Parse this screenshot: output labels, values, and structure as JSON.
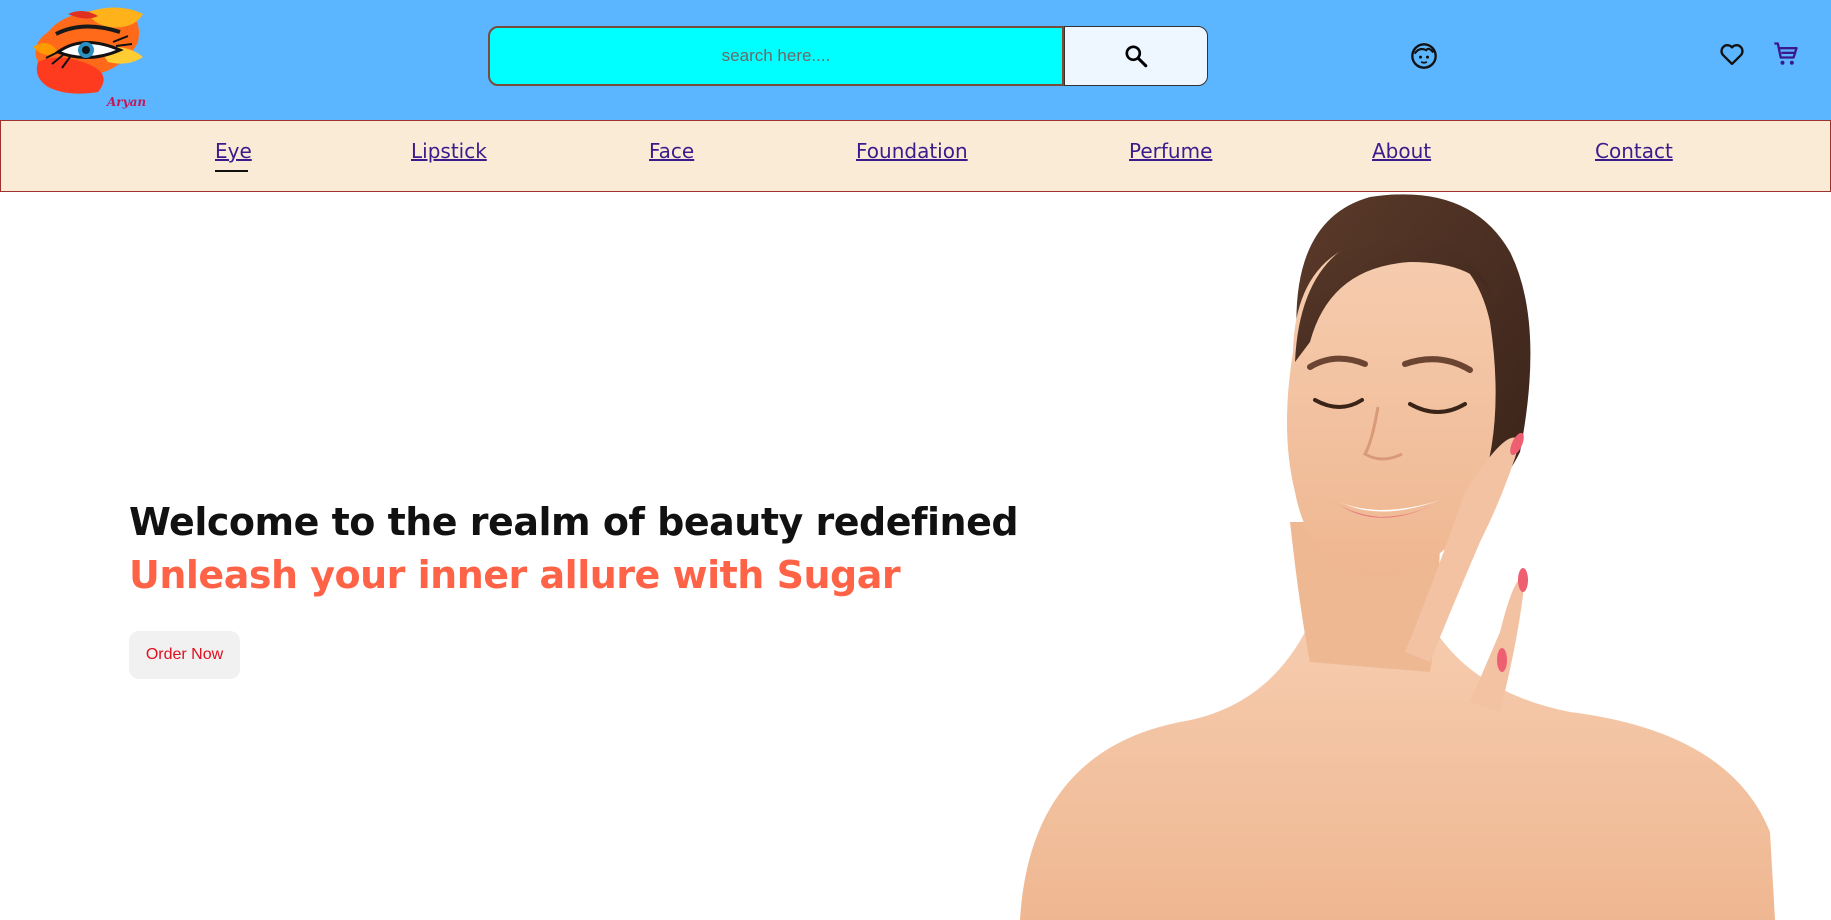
{
  "logo": {
    "text": "Aryan",
    "icon": "eye-paint-logo"
  },
  "search": {
    "placeholder": "search here....",
    "button_icon": "search-icon"
  },
  "header_icons": {
    "account": "face-icon",
    "wishlist": "heart-icon",
    "cart": "cart-icon"
  },
  "nav": {
    "active": "Eye",
    "items": [
      {
        "label": "Eye"
      },
      {
        "label": "Lipstick"
      },
      {
        "label": "Face"
      },
      {
        "label": "Foundation"
      },
      {
        "label": "Perfume"
      },
      {
        "label": "About"
      },
      {
        "label": "Contact"
      }
    ]
  },
  "hero": {
    "title": "Welcome to the realm of beauty redefined",
    "subtitle": "Unleash your inner allure with Sugar",
    "cta_label": "Order Now"
  },
  "colors": {
    "header_bg": "#5cb6ff",
    "search_bg": "#00ffff",
    "nav_bg": "#faebd7",
    "nav_link": "#3b1c8c",
    "subtitle": "#ff6347",
    "cta_text": "#e0101e"
  }
}
